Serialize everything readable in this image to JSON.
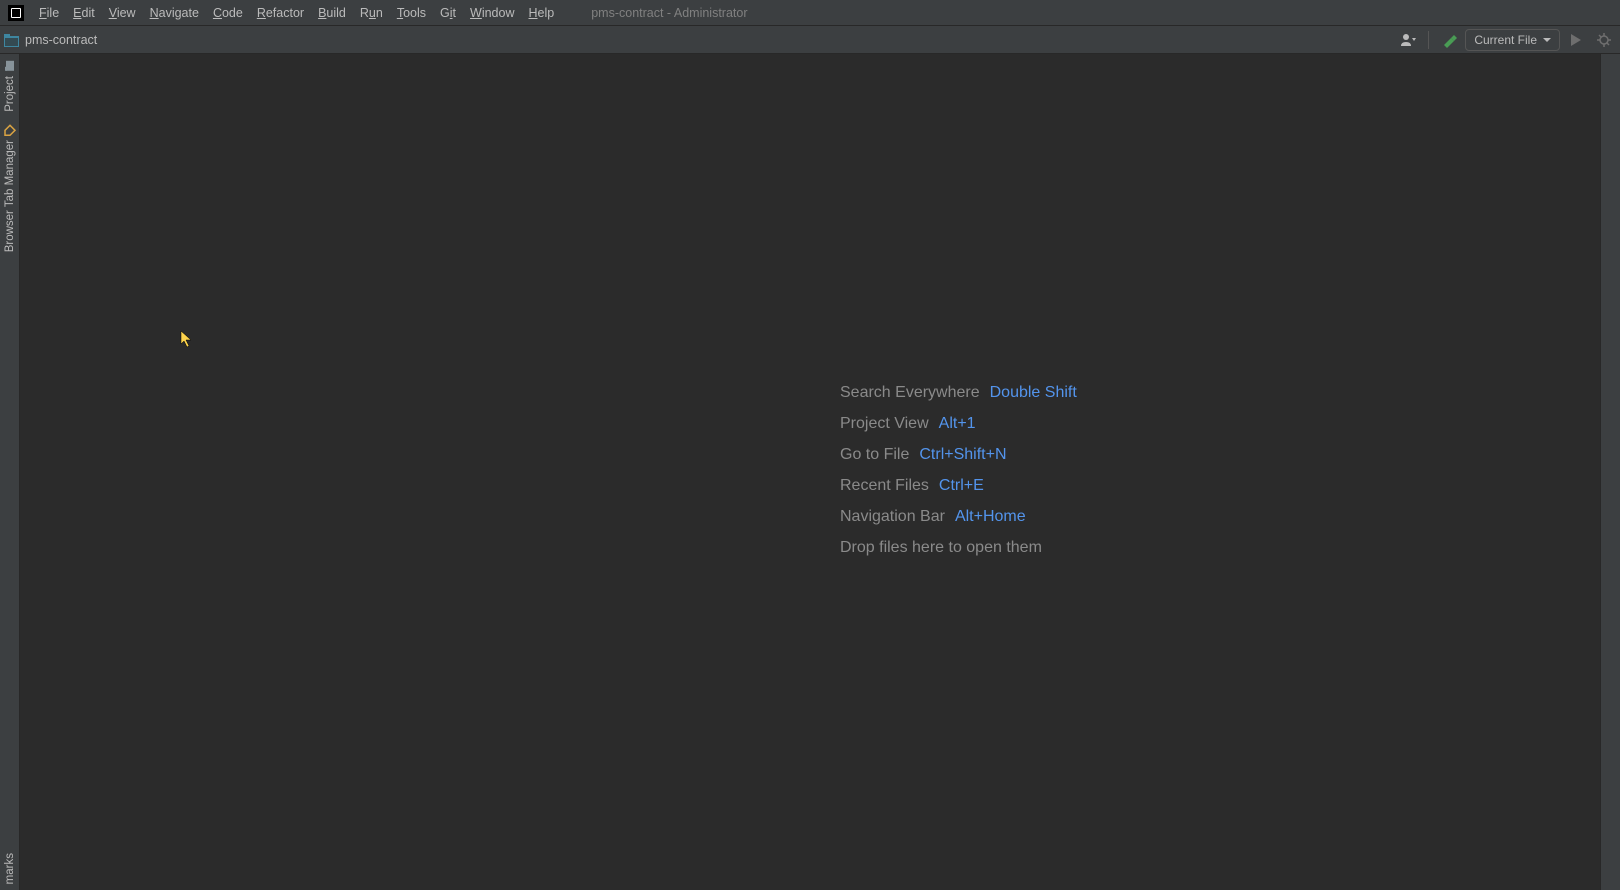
{
  "window_title": "pms-contract - Administrator",
  "menu": {
    "file": "File",
    "edit": "Edit",
    "view": "View",
    "navigate": "Navigate",
    "code": "Code",
    "refactor": "Refactor",
    "build": "Build",
    "run": "Run",
    "tools": "Tools",
    "git": "Git",
    "window": "Window",
    "help": "Help"
  },
  "toolbar": {
    "project_name": "pms-contract",
    "run_config_label": "Current File"
  },
  "sidebar": {
    "project": "Project",
    "browser_tab_manager": "Browser Tab Manager",
    "bookmarks": "marks"
  },
  "hints": {
    "search_everywhere": {
      "label": "Search Everywhere",
      "shortcut": "Double Shift"
    },
    "project_view": {
      "label": "Project View",
      "shortcut": "Alt+1"
    },
    "go_to_file": {
      "label": "Go to File",
      "shortcut": "Ctrl+Shift+N"
    },
    "recent_files": {
      "label": "Recent Files",
      "shortcut": "Ctrl+E"
    },
    "navigation_bar": {
      "label": "Navigation Bar",
      "shortcut": "Alt+Home"
    },
    "drop_hint": "Drop files here to open them"
  }
}
